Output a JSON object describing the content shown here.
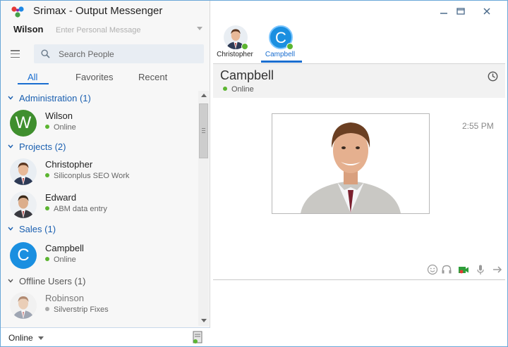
{
  "app": {
    "title": "Srimax - Output Messenger"
  },
  "me": {
    "name": "Wilson",
    "personal_message_placeholder": "Enter Personal Message"
  },
  "search": {
    "placeholder": "Search People"
  },
  "tabs": [
    {
      "label": "All",
      "active": true
    },
    {
      "label": "Favorites",
      "active": false
    },
    {
      "label": "Recent",
      "active": false
    }
  ],
  "groups": [
    {
      "name": "Administration (1)",
      "contacts": [
        {
          "name": "Wilson",
          "status": "Online",
          "initial": "W"
        }
      ]
    },
    {
      "name": "Projects (2)",
      "contacts": [
        {
          "name": "Christopher",
          "status": "Siliconplus SEO Work"
        },
        {
          "name": "Edward",
          "status": "ABM data entry"
        }
      ]
    },
    {
      "name": "Sales (1)",
      "contacts": [
        {
          "name": "Campbell",
          "status": "Online",
          "initial": "C"
        }
      ]
    },
    {
      "name": "Offline Users (1)",
      "contacts": [
        {
          "name": "Robinson",
          "status": "Silverstrip Fixes"
        }
      ]
    }
  ],
  "statusbar": {
    "status": "Online"
  },
  "chat_tabs": [
    {
      "label": "Christopher",
      "active": false
    },
    {
      "label": "Campbell",
      "initial": "C",
      "active": true
    }
  ],
  "chat": {
    "name": "Campbell",
    "status": "Online",
    "message_time": "2:55 PM"
  },
  "colors": {
    "accent": "#1a6ed0",
    "online": "#5cb531",
    "group_text": "#1a5fb0",
    "wilson_avatar": "#3f8f2e",
    "campbell_avatar": "#1a8fe0"
  },
  "icons": [
    "app-logo-icon",
    "menu-icon",
    "search-icon",
    "chevron-down-icon",
    "server-icon",
    "minimize-icon",
    "maximize-icon",
    "close-icon",
    "history-icon",
    "emoji-icon",
    "headset-icon",
    "video-icon",
    "microphone-icon",
    "send-icon"
  ]
}
